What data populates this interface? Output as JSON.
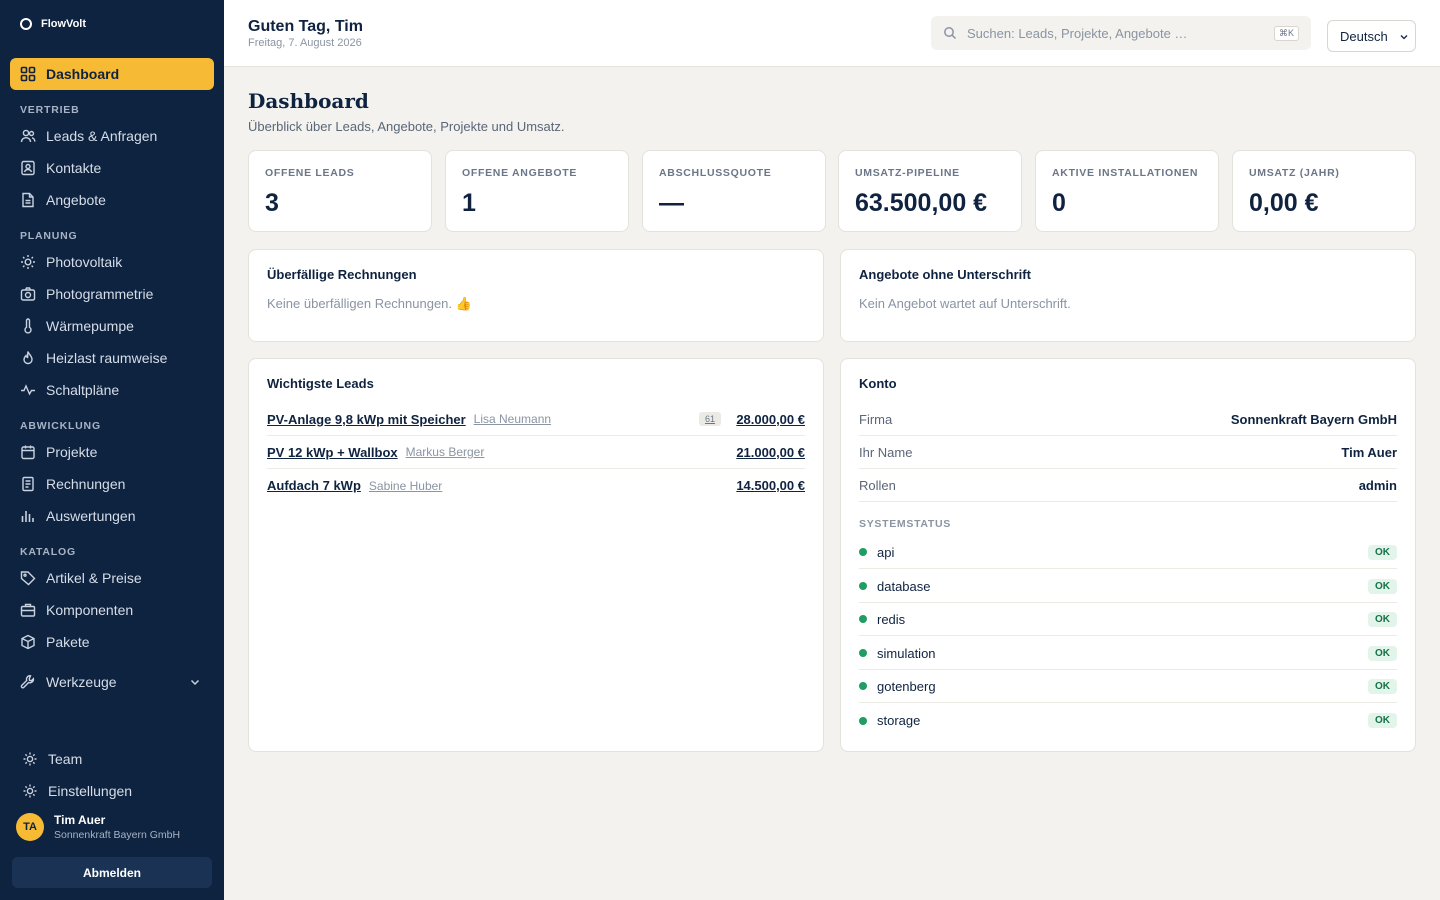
{
  "brand": {
    "name": "FlowVolt"
  },
  "sidebar": {
    "dashboard": "Dashboard",
    "sections": {
      "vertrieb": "VERTRIEB",
      "planung": "PLANUNG",
      "abwicklung": "ABWICKLUNG",
      "katalog": "KATALOG"
    },
    "items": {
      "leads": "Leads & Anfragen",
      "kontakte": "Kontakte",
      "angebote": "Angebote",
      "photovoltaik": "Photovoltaik",
      "photogrammetrie": "Photogrammetrie",
      "waermepumpe": "Wärmepumpe",
      "heizlast": "Heizlast raumweise",
      "schaltplaene": "Schaltpläne",
      "projekte": "Projekte",
      "rechnungen": "Rechnungen",
      "auswertungen": "Auswertungen",
      "artikel": "Artikel & Preise",
      "komponenten": "Komponenten",
      "pakete": "Pakete",
      "werkzeuge": "Werkzeuge",
      "team": "Team",
      "einstellungen": "Einstellungen"
    },
    "user": {
      "initials": "TA",
      "name": "Tim Auer",
      "company": "Sonnenkraft Bayern GmbH"
    },
    "logout": "Abmelden"
  },
  "topbar": {
    "greeting": "Guten Tag, Tim",
    "date": "Freitag, 7. August 2026",
    "search_placeholder": "Suchen: Leads, Projekte, Angebote …",
    "shortcut": "⌘K",
    "language": "Deutsch"
  },
  "page": {
    "title": "Dashboard",
    "subtitle": "Überblick über Leads, Angebote, Projekte und Umsatz."
  },
  "stats": [
    {
      "label": "OFFENE LEADS",
      "value": "3"
    },
    {
      "label": "OFFENE ANGEBOTE",
      "value": "1"
    },
    {
      "label": "ABSCHLUSSQUOTE",
      "value": "—"
    },
    {
      "label": "UMSATZ-PIPELINE",
      "value": "63.500,00 €"
    },
    {
      "label": "AKTIVE INSTALLATIONEN",
      "value": "0"
    },
    {
      "label": "UMSATZ (JAHR)",
      "value": "0,00 €"
    }
  ],
  "overdue": {
    "title": "Überfällige Rechnungen",
    "empty": "Keine überfälligen Rechnungen. 👍"
  },
  "unsigned": {
    "title": "Angebote ohne Unterschrift",
    "empty": "Kein Angebot wartet auf Unterschrift."
  },
  "leads": {
    "title": "Wichtigste Leads",
    "rows": [
      {
        "title": "PV-Anlage 9,8 kWp mit Speicher",
        "person": "Lisa Neumann",
        "badge": "61",
        "amount": "28.000,00 €"
      },
      {
        "title": "PV 12 kWp + Wallbox",
        "person": "Markus Berger",
        "amount": "21.000,00 €"
      },
      {
        "title": "Aufdach 7 kWp",
        "person": "Sabine Huber",
        "amount": "14.500,00 €"
      }
    ]
  },
  "account": {
    "title": "Konto",
    "rows": [
      {
        "key": "Firma",
        "value": "Sonnenkraft Bayern GmbH"
      },
      {
        "key": "Ihr Name",
        "value": "Tim Auer"
      },
      {
        "key": "Rollen",
        "value": "admin"
      }
    ],
    "system_title": "SYSTEMSTATUS",
    "system": [
      {
        "name": "api",
        "status": "OK"
      },
      {
        "name": "database",
        "status": "OK"
      },
      {
        "name": "redis",
        "status": "OK"
      },
      {
        "name": "simulation",
        "status": "OK"
      },
      {
        "name": "gotenberg",
        "status": "OK"
      },
      {
        "name": "storage",
        "status": "OK"
      }
    ],
    "status_color": "#1f9d62"
  },
  "colors": {
    "sidebar": "#0e2340",
    "accent": "#f7ba34",
    "background": "#f3f2ee"
  }
}
